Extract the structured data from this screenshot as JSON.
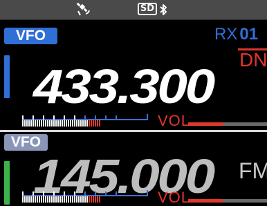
{
  "status_bar": {
    "icons": [
      "gps-satellite-icon",
      "sd-card-icon",
      "bluetooth-icon"
    ],
    "sd_label": "SD"
  },
  "band_a": {
    "mode": "VFO",
    "frequency": "433.300",
    "rx_label": "RX 01",
    "digital_mode": "DN",
    "volume_label": "VOL",
    "volume_level": 0.44,
    "s_meter_level": 0.22,
    "active": true
  },
  "band_b": {
    "mode": "VFO",
    "frequency": "145.000",
    "modulation": "FM",
    "volume_label": "VOL",
    "volume_level": 0.44,
    "s_meter_level": 0.22,
    "active": false
  },
  "colors": {
    "active_tag": "#2f6fd6",
    "inactive_tag": "#8a96b8",
    "active_bar": "#2f6fd6",
    "inactive_bar": "#3bb34a",
    "rx_label": "#2f6fd6",
    "digital_mode": "#e0352b",
    "volume_fill": "#e0382a",
    "meter_peak": "#e0382a",
    "meter_scale": "#3f6fd0"
  }
}
